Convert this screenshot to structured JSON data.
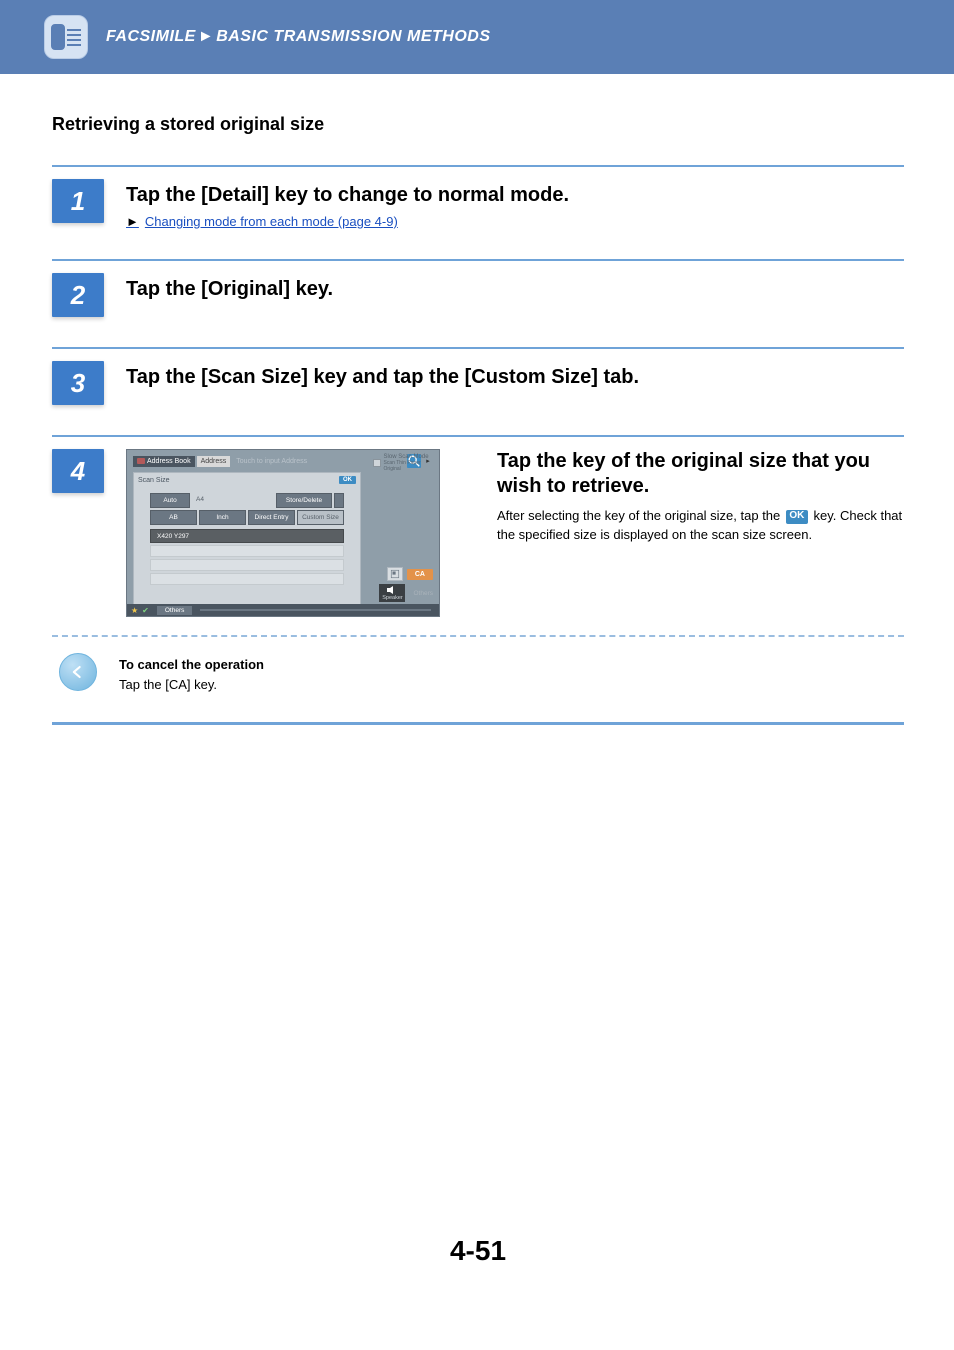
{
  "header": {
    "breadcrumb_1": "FACSIMILE",
    "breadcrumb_2": "BASIC TRANSMISSION METHODS"
  },
  "section_title": "Retrieving a stored original size",
  "steps": [
    {
      "num": "1",
      "heading": "Tap the [Detail] key to change to normal mode.",
      "link_arrow": "►",
      "link_text": "Changing mode from each mode (page 4-9)"
    },
    {
      "num": "2",
      "heading": "Tap the [Original] key."
    },
    {
      "num": "3",
      "heading": "Tap the [Scan Size] key and tap the [Custom Size] tab."
    }
  ],
  "step4": {
    "num": "4",
    "heading": "Tap the key of the original size that you wish to retrieve.",
    "desc_1": "After selecting the key of the original size, tap the ",
    "desc_ok": "OK",
    "desc_2": " key. Check that the specified size is displayed on the scan size screen.",
    "screen": {
      "address_book": "Address Book",
      "address": "Address",
      "touch": "Touch to input Address",
      "side_label_1": "Slow Scan Mode",
      "side_label_2": "Scan Thin Paper Original",
      "panel_title": "Scan Size",
      "panel_ok": "OK",
      "auto": "Auto",
      "a4": "A4",
      "store_delete": "Store/Delete",
      "tab_ab": "AB",
      "tab_inch": "Inch",
      "tab_direct": "Direct Entry",
      "tab_custom": "Custom Size",
      "size_value": "X420 Y297",
      "others": "Others",
      "ca": "CA",
      "speaker": "Speaker",
      "ghost": "Others"
    }
  },
  "note": {
    "title": "To cancel the operation",
    "text": "Tap the [CA] key."
  },
  "page_number": "4-51"
}
